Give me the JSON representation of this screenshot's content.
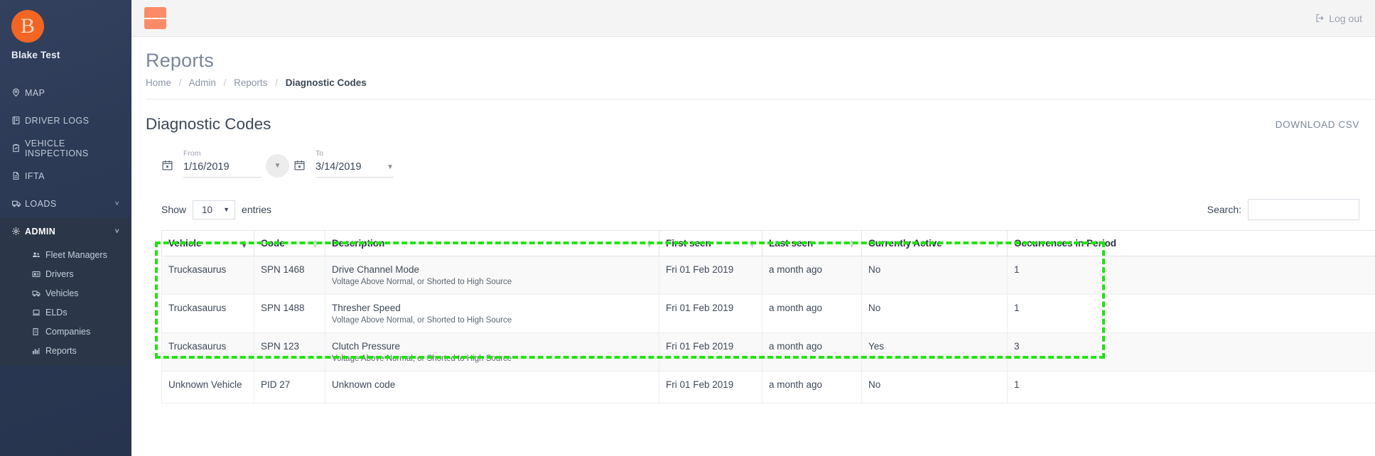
{
  "sidebar": {
    "brand": {
      "initial": "B",
      "name": "Blake Test",
      "logo_color": "#f26522"
    },
    "items": [
      {
        "label": "MAP",
        "icon": "map-pin-icon",
        "expandable": false
      },
      {
        "label": "DRIVER LOGS",
        "icon": "book-icon",
        "expandable": false
      },
      {
        "label": "VEHICLE INSPECTIONS",
        "icon": "clipboard-check-icon",
        "expandable": false
      },
      {
        "label": "IFTA",
        "icon": "file-icon",
        "expandable": false
      },
      {
        "label": "LOADS",
        "icon": "truck-icon",
        "expandable": true,
        "chevron": "˅"
      },
      {
        "label": "ADMIN",
        "icon": "gear-icon",
        "expandable": true,
        "chevron": "˅",
        "active": true
      }
    ],
    "admin_subitems": [
      {
        "label": "Fleet Managers",
        "icon": "users-icon"
      },
      {
        "label": "Drivers",
        "icon": "id-card-icon"
      },
      {
        "label": "Vehicles",
        "icon": "truck-icon"
      },
      {
        "label": "ELDs",
        "icon": "laptop-icon"
      },
      {
        "label": "Companies",
        "icon": "building-icon"
      },
      {
        "label": "Reports",
        "icon": "bar-chart-icon"
      }
    ]
  },
  "topbar": {
    "menu_toggle": "hamburger-icon",
    "logout_label": "Log out",
    "toggle_color": "#fb8b68"
  },
  "page": {
    "title": "Reports",
    "breadcrumb": [
      {
        "label": "Home",
        "current": false
      },
      {
        "label": "Admin",
        "current": false
      },
      {
        "label": "Reports",
        "current": false
      },
      {
        "label": "Diagnostic Codes",
        "current": true
      }
    ],
    "breadcrumb_separator": "/"
  },
  "card": {
    "title": "Diagnostic Codes",
    "download_label": "DOWNLOAD CSV"
  },
  "filters": {
    "from": {
      "label": "From",
      "value": "1/16/2019"
    },
    "to": {
      "label": "To",
      "value": "3/14/2019"
    }
  },
  "table_controls": {
    "show_label": "Show",
    "entries_value": "10",
    "entries_label": "entries",
    "search_label": "Search:",
    "search_value": "",
    "search_placeholder": ""
  },
  "table": {
    "columns": [
      {
        "label": "Vehicle",
        "sorted": true
      },
      {
        "label": "Code",
        "sorted": false
      },
      {
        "label": "Description",
        "sorted": false
      },
      {
        "label": "First seen",
        "sorted": false
      },
      {
        "label": "Last seen",
        "sorted": false
      },
      {
        "label": "Currently Active",
        "sorted": false
      },
      {
        "label": "Occurrences in Period",
        "sorted": false
      }
    ],
    "rows": [
      {
        "vehicle": "Truckasaurus",
        "code": "SPN 1468",
        "description_title": "Drive Channel Mode",
        "description_sub": "Voltage Above Normal, or Shorted to High Source",
        "first_seen": "Fri 01 Feb 2019",
        "last_seen": "a month ago",
        "currently_active": "No",
        "occurrences": "1"
      },
      {
        "vehicle": "Truckasaurus",
        "code": "SPN 1488",
        "description_title": "Thresher Speed",
        "description_sub": "Voltage Above Normal, or Shorted to High Source",
        "first_seen": "Fri 01 Feb 2019",
        "last_seen": "a month ago",
        "currently_active": "No",
        "occurrences": "1"
      },
      {
        "vehicle": "Truckasaurus",
        "code": "SPN 123",
        "description_title": "Clutch Pressure",
        "description_sub": "Voltage Above Normal, or Shorted to High Source",
        "first_seen": "Fri 01 Feb 2019",
        "last_seen": "a month ago",
        "currently_active": "Yes",
        "occurrences": "3"
      },
      {
        "vehicle": "Unknown Vehicle",
        "code": "PID 27",
        "description_title": "Unknown code",
        "description_sub": "",
        "first_seen": "Fri 01 Feb 2019",
        "last_seen": "a month ago",
        "currently_active": "No",
        "occurrences": "1"
      }
    ]
  },
  "annotation": {
    "highlight_color": "#22e312"
  }
}
